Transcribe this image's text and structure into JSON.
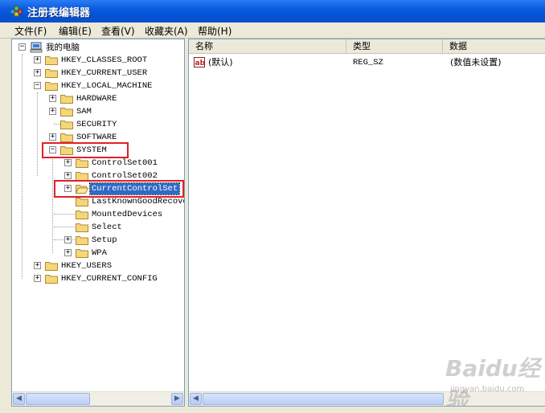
{
  "window": {
    "title": "注册表编辑器",
    "icon": "regedit-icon"
  },
  "menubar": {
    "items": [
      {
        "label": "文件(F)"
      },
      {
        "label": "编辑(E)"
      },
      {
        "label": "查看(V)"
      },
      {
        "label": "收藏夹(A)"
      },
      {
        "label": "帮助(H)"
      }
    ]
  },
  "tree": {
    "root": "我的电脑",
    "nodes": [
      {
        "label": "HKEY_CLASSES_ROOT",
        "expander": "+"
      },
      {
        "label": "HKEY_CURRENT_USER",
        "expander": "+"
      },
      {
        "label": "HKEY_LOCAL_MACHINE",
        "expander": "−"
      },
      {
        "label": "HARDWARE",
        "expander": "+"
      },
      {
        "label": "SAM",
        "expander": "+"
      },
      {
        "label": "SECURITY",
        "expander": ""
      },
      {
        "label": "SOFTWARE",
        "expander": "+"
      },
      {
        "label": "SYSTEM",
        "expander": "−"
      },
      {
        "label": "ControlSet001",
        "expander": "+"
      },
      {
        "label": "ControlSet002",
        "expander": "+"
      },
      {
        "label": "CurrentControlSet",
        "expander": "+",
        "selected": true
      },
      {
        "label": "LastKnownGoodRecove",
        "expander": ""
      },
      {
        "label": "MountedDevices",
        "expander": ""
      },
      {
        "label": "Select",
        "expander": ""
      },
      {
        "label": "Setup",
        "expander": "+"
      },
      {
        "label": "WPA",
        "expander": "+"
      },
      {
        "label": "HKEY_USERS",
        "expander": "+"
      },
      {
        "label": "HKEY_CURRENT_CONFIG",
        "expander": "+"
      }
    ]
  },
  "list": {
    "columns": [
      "名称",
      "类型",
      "数据"
    ],
    "rows": [
      {
        "name": "(默认)",
        "type": "REG_SZ",
        "data": "(数值未设置)"
      }
    ]
  },
  "watermark": {
    "brand": "Baidu经验",
    "site": "jingyan.baidu.com"
  },
  "colors": {
    "titlebar": "#0a5be0",
    "highlight_box": "#e0202a",
    "selection": "#316ac5"
  }
}
